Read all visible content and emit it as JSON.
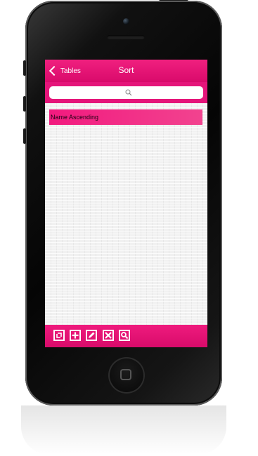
{
  "navbar": {
    "back_label": "Tables",
    "title": "Sort"
  },
  "search": {
    "placeholder": ""
  },
  "list": {
    "items": [
      {
        "label": "Name Ascending"
      }
    ]
  },
  "toolbar": {
    "buttons": [
      {
        "icon": "refresh-icon"
      },
      {
        "icon": "add-icon"
      },
      {
        "icon": "edit-icon"
      },
      {
        "icon": "delete-icon"
      },
      {
        "icon": "search-icon"
      }
    ]
  },
  "colors": {
    "accent": "#e5157a",
    "list_item": "#f21a7f",
    "phone": "#0a0a0a"
  }
}
